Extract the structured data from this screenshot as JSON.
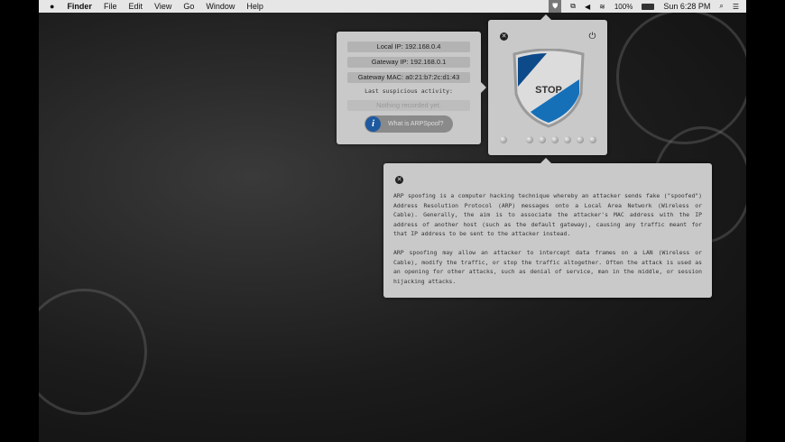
{
  "menubar": {
    "apple": "",
    "app": "Finder",
    "items": [
      "File",
      "Edit",
      "View",
      "Go",
      "Window",
      "Help"
    ],
    "battery": "100%",
    "clock": "Sun 6:28 PM"
  },
  "arp_panel": {
    "local_ip": "Local IP: 192.168.0.4",
    "gateway_ip": "Gateway IP: 192.168.0.1",
    "gateway_mac": "Gateway MAC: a0:21:b7:2c:d1:43",
    "last_activity_label": "Last suspicious activity:",
    "last_activity_value": "Nothing recorded yet.",
    "what_button": "What is ARPSpoof?"
  },
  "shield_panel": {
    "shield_label": "STOP",
    "colors": {
      "blue_dark": "#0d4a8a",
      "blue": "#1570b8"
    }
  },
  "info_panel": {
    "paragraph1": "ARP spoofing is a computer hacking technique whereby an attacker sends fake (\"spoofed\") Address Resolution Protocol (ARP) messages onto a Local Area Network (Wireless or Cable). Generally, the aim is to associate the attacker's MAC address with the IP address of another host (such as the default gateway), causing any traffic meant for that IP address to be sent to the attacker instead.",
    "paragraph2": "ARP spoofing may allow an attacker to intercept data frames on a LAN (Wireless or Cable), modify the traffic, or stop the traffic altogether. Often the attack is used as an opening for other attacks, such as denial of service, man in the middle, or session hijacking attacks."
  }
}
